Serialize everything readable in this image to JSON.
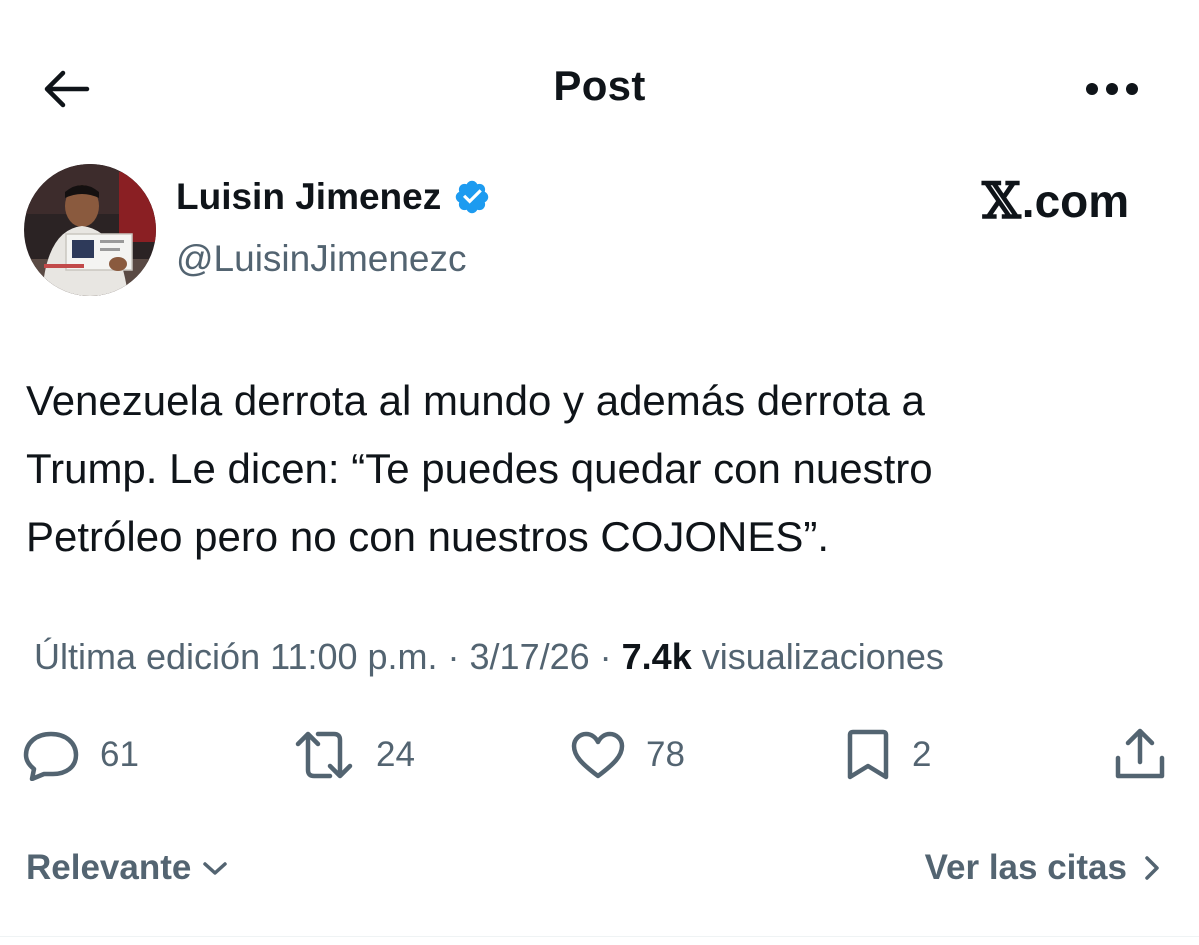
{
  "header": {
    "title": "Post",
    "back_icon": "arrow-left-icon",
    "more_icon": "more-horizontal-icon"
  },
  "author": {
    "name": "Luisin Jimenez",
    "handle": "@LuisinJimenezc",
    "verified": true,
    "verified_color": "#1d9bf0"
  },
  "brand": {
    "x_glyph": "𝕏",
    "text": ".com"
  },
  "post": {
    "lines": [
      "Venezuela derrota al mundo y además derrota a",
      "Trump. Le dicen: “Te puedes quedar con nuestro",
      "Petróleo pero no con nuestros COJONES”."
    ]
  },
  "meta": {
    "edited_label": "Última edición 11:00 p.m.",
    "separator": "·",
    "date": "3/17/26",
    "views_count": "7.4k",
    "views_label": "visualizaciones"
  },
  "actions": {
    "replies": "61",
    "reposts": "24",
    "likes": "78",
    "bookmarks": "2"
  },
  "footer": {
    "sort_label": "Relevante",
    "quotes_label": "Ver las citas"
  },
  "colors": {
    "text_primary": "#0f1419",
    "text_secondary": "#536471",
    "accent": "#1d9bf0"
  }
}
